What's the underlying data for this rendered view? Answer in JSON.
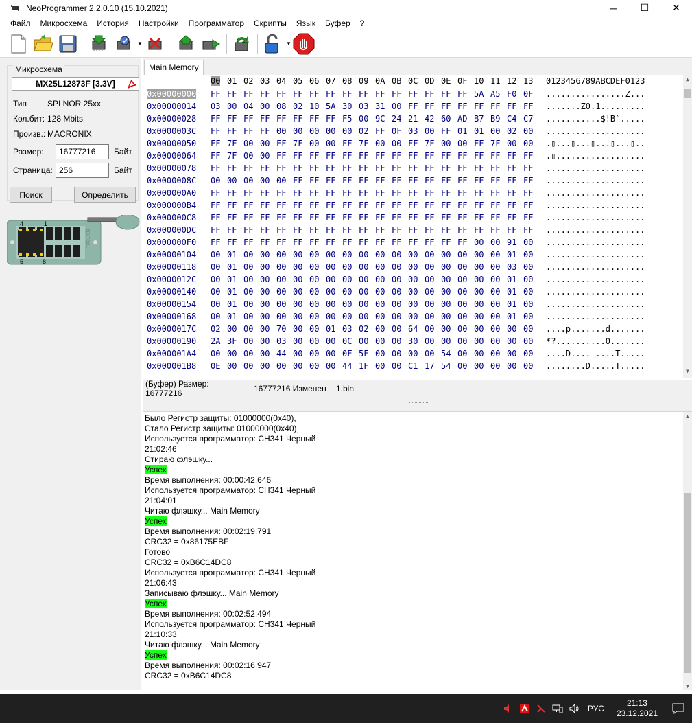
{
  "window": {
    "title": "NeoProgrammer 2.2.0.10 (15.10.2021)",
    "minimize": "─",
    "maximize": "☐",
    "close": "✕"
  },
  "menu": [
    "Файл",
    "Микросхема",
    "История",
    "Настройки",
    "Программатор",
    "Скрипты",
    "Язык",
    "Буфер",
    "?"
  ],
  "toolbar": {
    "icons": [
      "new-file-icon",
      "open-folder-icon",
      "save-icon",
      "read-chip-icon",
      "verify-chip-icon",
      "erase-chip-icon",
      "write-chip-icon",
      "compare-chip-icon",
      "auto-chip-icon",
      "protection-lock-icon",
      "stop-icon"
    ]
  },
  "chip": {
    "group_title": "Микросхема",
    "name": "MX25L12873F [3.3V]",
    "type_label": "Тип",
    "type_value": "SPI NOR 25xx",
    "bits_label": "Кол.бит:",
    "bits_value": "128 Mbits",
    "vendor_label": "Произв.:",
    "vendor_value": "MACRONIX",
    "size_label": "Размер:",
    "size_value": "16777216",
    "size_unit": "Байт",
    "page_label": "Страница:",
    "page_value": "256",
    "page_unit": "Байт",
    "search_button": "Поиск",
    "detect_button": "Определить",
    "socket_pin1": "1",
    "socket_pin4": "4",
    "socket_pin5": "5",
    "socket_pin8": "8",
    "socket_brand": "TEXTOOL"
  },
  "hex": {
    "tab": "Main Memory",
    "columns": [
      "00",
      "01",
      "02",
      "03",
      "04",
      "05",
      "06",
      "07",
      "08",
      "09",
      "0A",
      "0B",
      "0C",
      "0D",
      "0E",
      "0F",
      "10",
      "11",
      "12",
      "13"
    ],
    "ascii_header": "0123456789ABCDEF0123",
    "rows": [
      {
        "addr": "0x00000000",
        "bytes": [
          "FF",
          "FF",
          "FF",
          "FF",
          "FF",
          "FF",
          "FF",
          "FF",
          "FF",
          "FF",
          "FF",
          "FF",
          "FF",
          "FF",
          "FF",
          "FF",
          "5A",
          "A5",
          "F0",
          "0F"
        ],
        "ascii": "................Z..."
      },
      {
        "addr": "0x00000014",
        "bytes": [
          "03",
          "00",
          "04",
          "00",
          "08",
          "02",
          "10",
          "5A",
          "30",
          "03",
          "31",
          "00",
          "FF",
          "FF",
          "FF",
          "FF",
          "FF",
          "FF",
          "FF",
          "FF"
        ],
        "ascii": ".......Z0.1........."
      },
      {
        "addr": "0x00000028",
        "bytes": [
          "FF",
          "FF",
          "FF",
          "FF",
          "FF",
          "FF",
          "FF",
          "FF",
          "F5",
          "00",
          "9C",
          "24",
          "21",
          "42",
          "60",
          "AD",
          "B7",
          "B9",
          "C4",
          "C7"
        ],
        "ascii": "...........$!B`....."
      },
      {
        "addr": "0x0000003C",
        "bytes": [
          "FF",
          "FF",
          "FF",
          "FF",
          "00",
          "00",
          "00",
          "00",
          "00",
          "02",
          "FF",
          "0F",
          "03",
          "00",
          "FF",
          "01",
          "01",
          "00",
          "02",
          "00"
        ],
        "ascii": "...................."
      },
      {
        "addr": "0x00000050",
        "bytes": [
          "FF",
          "7F",
          "00",
          "00",
          "FF",
          "7F",
          "00",
          "00",
          "FF",
          "7F",
          "00",
          "00",
          "FF",
          "7F",
          "00",
          "00",
          "FF",
          "7F",
          "00",
          "00"
        ],
        "ascii": ".▯...▯...▯...▯...▯.."
      },
      {
        "addr": "0x00000064",
        "bytes": [
          "FF",
          "7F",
          "00",
          "00",
          "FF",
          "FF",
          "FF",
          "FF",
          "FF",
          "FF",
          "FF",
          "FF",
          "FF",
          "FF",
          "FF",
          "FF",
          "FF",
          "FF",
          "FF",
          "FF"
        ],
        "ascii": ".▯.................."
      },
      {
        "addr": "0x00000078",
        "bytes": [
          "FF",
          "FF",
          "FF",
          "FF",
          "FF",
          "FF",
          "FF",
          "FF",
          "FF",
          "FF",
          "FF",
          "FF",
          "FF",
          "FF",
          "FF",
          "FF",
          "FF",
          "FF",
          "FF",
          "FF"
        ],
        "ascii": "...................."
      },
      {
        "addr": "0x0000008C",
        "bytes": [
          "00",
          "00",
          "00",
          "00",
          "00",
          "FF",
          "FF",
          "FF",
          "FF",
          "FF",
          "FF",
          "FF",
          "FF",
          "FF",
          "FF",
          "FF",
          "FF",
          "FF",
          "FF",
          "FF"
        ],
        "ascii": "...................."
      },
      {
        "addr": "0x000000A0",
        "bytes": [
          "FF",
          "FF",
          "FF",
          "FF",
          "FF",
          "FF",
          "FF",
          "FF",
          "FF",
          "FF",
          "FF",
          "FF",
          "FF",
          "FF",
          "FF",
          "FF",
          "FF",
          "FF",
          "FF",
          "FF"
        ],
        "ascii": "...................."
      },
      {
        "addr": "0x000000B4",
        "bytes": [
          "FF",
          "FF",
          "FF",
          "FF",
          "FF",
          "FF",
          "FF",
          "FF",
          "FF",
          "FF",
          "FF",
          "FF",
          "FF",
          "FF",
          "FF",
          "FF",
          "FF",
          "FF",
          "FF",
          "FF"
        ],
        "ascii": "...................."
      },
      {
        "addr": "0x000000C8",
        "bytes": [
          "FF",
          "FF",
          "FF",
          "FF",
          "FF",
          "FF",
          "FF",
          "FF",
          "FF",
          "FF",
          "FF",
          "FF",
          "FF",
          "FF",
          "FF",
          "FF",
          "FF",
          "FF",
          "FF",
          "FF"
        ],
        "ascii": "...................."
      },
      {
        "addr": "0x000000DC",
        "bytes": [
          "FF",
          "FF",
          "FF",
          "FF",
          "FF",
          "FF",
          "FF",
          "FF",
          "FF",
          "FF",
          "FF",
          "FF",
          "FF",
          "FF",
          "FF",
          "FF",
          "FF",
          "FF",
          "FF",
          "FF"
        ],
        "ascii": "...................."
      },
      {
        "addr": "0x000000F0",
        "bytes": [
          "FF",
          "FF",
          "FF",
          "FF",
          "FF",
          "FF",
          "FF",
          "FF",
          "FF",
          "FF",
          "FF",
          "FF",
          "FF",
          "FF",
          "FF",
          "FF",
          "00",
          "00",
          "91",
          "00"
        ],
        "ascii": "...................."
      },
      {
        "addr": "0x00000104",
        "bytes": [
          "00",
          "01",
          "00",
          "00",
          "00",
          "00",
          "00",
          "00",
          "00",
          "00",
          "00",
          "00",
          "00",
          "00",
          "00",
          "00",
          "00",
          "00",
          "01",
          "00"
        ],
        "ascii": "...................."
      },
      {
        "addr": "0x00000118",
        "bytes": [
          "00",
          "01",
          "00",
          "00",
          "00",
          "00",
          "00",
          "00",
          "00",
          "00",
          "00",
          "00",
          "00",
          "00",
          "00",
          "00",
          "00",
          "00",
          "03",
          "00"
        ],
        "ascii": "...................."
      },
      {
        "addr": "0x0000012C",
        "bytes": [
          "00",
          "01",
          "00",
          "00",
          "00",
          "00",
          "00",
          "00",
          "00",
          "00",
          "00",
          "00",
          "00",
          "00",
          "00",
          "00",
          "00",
          "00",
          "01",
          "00"
        ],
        "ascii": "...................."
      },
      {
        "addr": "0x00000140",
        "bytes": [
          "00",
          "01",
          "00",
          "00",
          "00",
          "00",
          "00",
          "00",
          "00",
          "00",
          "00",
          "00",
          "00",
          "00",
          "00",
          "00",
          "00",
          "00",
          "01",
          "00"
        ],
        "ascii": "...................."
      },
      {
        "addr": "0x00000154",
        "bytes": [
          "00",
          "01",
          "00",
          "00",
          "00",
          "00",
          "00",
          "00",
          "00",
          "00",
          "00",
          "00",
          "00",
          "00",
          "00",
          "00",
          "00",
          "00",
          "01",
          "00"
        ],
        "ascii": "...................."
      },
      {
        "addr": "0x00000168",
        "bytes": [
          "00",
          "01",
          "00",
          "00",
          "00",
          "00",
          "00",
          "00",
          "00",
          "00",
          "00",
          "00",
          "00",
          "00",
          "00",
          "00",
          "00",
          "00",
          "01",
          "00"
        ],
        "ascii": "...................."
      },
      {
        "addr": "0x0000017C",
        "bytes": [
          "02",
          "00",
          "00",
          "00",
          "70",
          "00",
          "00",
          "01",
          "03",
          "02",
          "00",
          "00",
          "64",
          "00",
          "00",
          "00",
          "00",
          "00",
          "00",
          "00"
        ],
        "ascii": "....p.......d......."
      },
      {
        "addr": "0x00000190",
        "bytes": [
          "2A",
          "3F",
          "00",
          "00",
          "03",
          "00",
          "00",
          "00",
          "0C",
          "00",
          "00",
          "00",
          "30",
          "00",
          "00",
          "00",
          "00",
          "00",
          "00",
          "00"
        ],
        "ascii": "*?..........0......."
      },
      {
        "addr": "0x000001A4",
        "bytes": [
          "00",
          "00",
          "00",
          "00",
          "44",
          "00",
          "00",
          "00",
          "0F",
          "5F",
          "00",
          "00",
          "00",
          "00",
          "54",
          "00",
          "00",
          "00",
          "00",
          "00"
        ],
        "ascii": "....D...._....T....."
      },
      {
        "addr": "0x000001B8",
        "bytes": [
          "0E",
          "00",
          "00",
          "00",
          "00",
          "00",
          "00",
          "00",
          "44",
          "1F",
          "00",
          "00",
          "C1",
          "17",
          "54",
          "00",
          "00",
          "00",
          "00",
          "00"
        ],
        "ascii": "........D.....T....."
      }
    ]
  },
  "status": {
    "buffer_size": "(Буфер) Размер: 16777216",
    "changed": "16777216 Изменен",
    "file": "1.bin"
  },
  "log": [
    {
      "text": "Было Регистр защиты: 01000000(0x40),",
      "ok": false
    },
    {
      "text": "Стало Регистр защиты: 01000000(0x40),",
      "ok": false
    },
    {
      "text": "Используется программатор: CH341 Черный",
      "ok": false
    },
    {
      "text": "21:02:46",
      "ok": false
    },
    {
      "text": "Стираю флэшку...",
      "ok": false
    },
    {
      "text": "Успех",
      "ok": true
    },
    {
      "text": "Время выполнения: 00:00:42.646",
      "ok": false
    },
    {
      "text": "Используется программатор: CH341 Черный",
      "ok": false
    },
    {
      "text": "21:04:01",
      "ok": false
    },
    {
      "text": "Читаю флэшку... Main Memory",
      "ok": false
    },
    {
      "text": "Успех",
      "ok": true
    },
    {
      "text": "Время выполнения: 00:02:19.791",
      "ok": false
    },
    {
      "text": "CRC32 = 0x86175EBF",
      "ok": false
    },
    {
      "text": "Готово",
      "ok": false
    },
    {
      "text": "CRC32 = 0xB6C14DC8",
      "ok": false
    },
    {
      "text": "Используется программатор: CH341 Черный",
      "ok": false
    },
    {
      "text": "21:06:43",
      "ok": false
    },
    {
      "text": "Записываю флэшку... Main Memory",
      "ok": false
    },
    {
      "text": "Успех",
      "ok": true
    },
    {
      "text": "Время выполнения: 00:02:52.494",
      "ok": false
    },
    {
      "text": "Используется программатор: CH341 Черный",
      "ok": false
    },
    {
      "text": "21:10:33",
      "ok": false
    },
    {
      "text": "Читаю флэшку... Main Memory",
      "ok": false
    },
    {
      "text": "Успех",
      "ok": true
    },
    {
      "text": "Время выполнения: 00:02:16.947",
      "ok": false
    },
    {
      "text": "CRC32 = 0xB6C14DC8",
      "ok": false
    }
  ],
  "taskbar": {
    "lang": "РУС",
    "time": "21:13",
    "date": "23.12.2021"
  }
}
